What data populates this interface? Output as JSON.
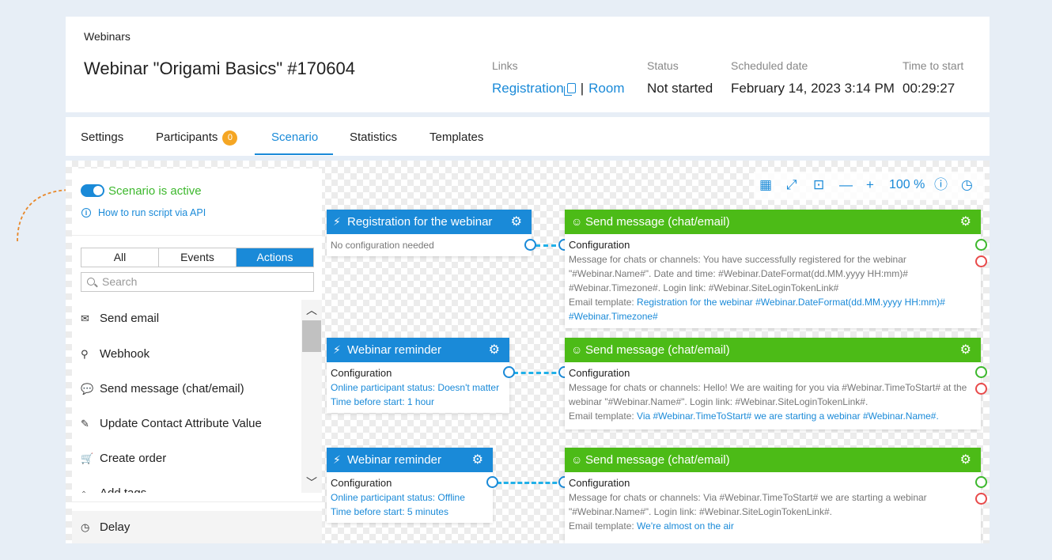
{
  "header": {
    "breadcrumb": "Webinars",
    "title": "Webinar \"Origami Basics\" #170604",
    "links_label": "Links",
    "registration_link": "Registration",
    "separator": "|",
    "room_link": "Room",
    "status_label": "Status",
    "status_value": "Not started",
    "scheduled_label": "Scheduled date",
    "scheduled_value": "February 14, 2023 3:14 PM",
    "time_label": "Time to start",
    "time_value": "00:29:27"
  },
  "tabs": [
    {
      "label": "Settings"
    },
    {
      "label": "Participants",
      "badge": "0"
    },
    {
      "label": "Scenario",
      "active": true
    },
    {
      "label": "Statistics"
    },
    {
      "label": "Templates"
    }
  ],
  "panel": {
    "active_label": "Scenario is active",
    "api_link": "How to run script via API",
    "filters": [
      "All",
      "Events",
      "Actions"
    ],
    "active_filter": "Actions",
    "search_placeholder": "Search",
    "items": [
      {
        "label": "Send email",
        "icon": "envelope-icon"
      },
      {
        "label": "Webhook",
        "icon": "webhook-icon"
      },
      {
        "label": "Send message (chat/email)",
        "icon": "chat-icon"
      },
      {
        "label": "Update Contact Attribute Value",
        "icon": "edit-icon"
      },
      {
        "label": "Create order",
        "icon": "cart-icon"
      },
      {
        "label": "Add tags",
        "icon": "tag-icon"
      }
    ],
    "delay_label": "Delay"
  },
  "toolbar": {
    "zoom": "100 %"
  },
  "colors": {
    "accent": "#1a8ad8",
    "green": "#4cbb17",
    "badge": "#f5a623",
    "success": "#3db82d",
    "error": "#e84a4a"
  },
  "nodes": {
    "trigger1": {
      "title": "Registration for the webinar",
      "body": "No configuration needed"
    },
    "trigger2": {
      "title": "Webinar reminder",
      "config": "Configuration",
      "line1": "Online participant status: Doesn't matter",
      "line2": "Time before start: 1 hour"
    },
    "trigger3": {
      "title": "Webinar reminder",
      "config": "Configuration",
      "line1": "Online participant status: Offline",
      "line2": "Time before start: 5 minutes"
    },
    "action1": {
      "title": "Send message (chat/email)",
      "config": "Configuration",
      "msg": "Message for chats or channels: You have successfully registered for the webinar \"#Webinar.Name#\". Date and time: #Webinar.DateFormat(dd.MM.yyyy HH:mm)# #Webinar.Timezone#. Login link: #Webinar.SiteLoginTokenLink#",
      "template_label": "Email template: ",
      "template_value": "Registration for the webinar #Webinar.DateFormat(dd.MM.yyyy HH:mm)# #Webinar.Timezone#"
    },
    "action2": {
      "title": "Send message (chat/email)",
      "config": "Configuration",
      "msg": "Message for chats or channels: Hello! We are waiting for you via #Webinar.TimeToStart# at the webinar \"#Webinar.Name#\". Login link: #Webinar.SiteLoginTokenLink#.",
      "template_label": "Email template: ",
      "template_value": "Via #Webinar.TimeToStart# we are starting a webinar #Webinar.Name#."
    },
    "action3": {
      "title": "Send message (chat/email)",
      "config": "Configuration",
      "msg": "Message for chats or channels: Via #Webinar.TimeToStart# we are starting a webinar \"#Webinar.Name#\". Login link: #Webinar.SiteLoginTokenLink#.",
      "template_label": "Email template: ",
      "template_value": "We're almost on the air"
    }
  }
}
